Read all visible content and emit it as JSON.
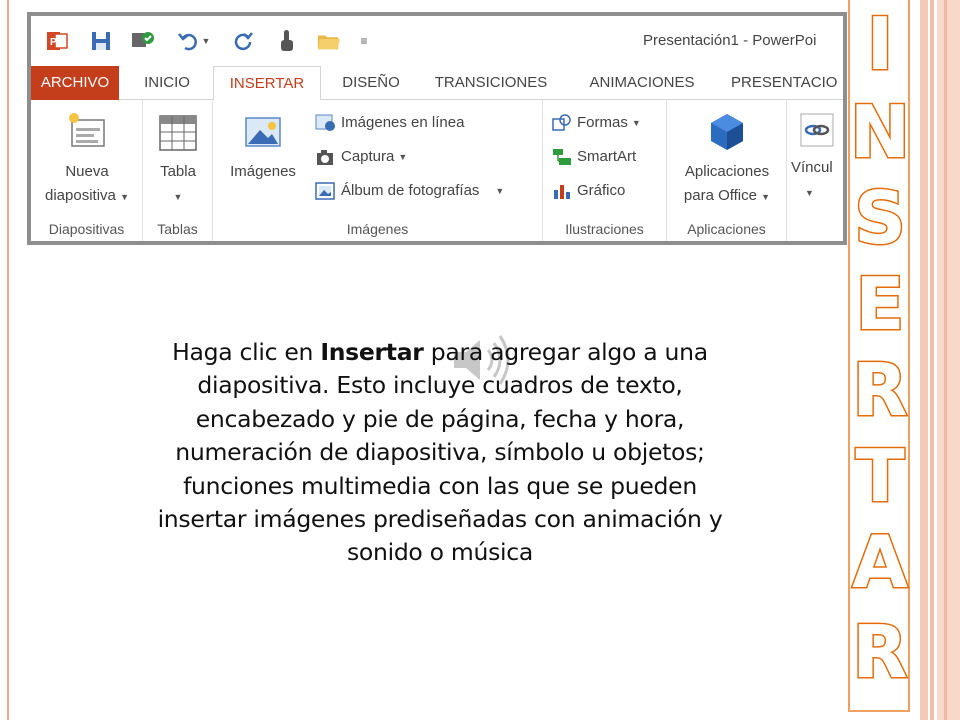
{
  "window": {
    "title": "Presentación1 - PowerPoi"
  },
  "tabs": [
    {
      "label": "ARCHIVO"
    },
    {
      "label": "INICIO"
    },
    {
      "label": "INSERTAR"
    },
    {
      "label": "DISEÑO"
    },
    {
      "label": "TRANSICIONES"
    },
    {
      "label": "ANIMACIONES"
    },
    {
      "label": "PRESENTACIO"
    }
  ],
  "groups": {
    "diapositivas": {
      "label": "Diapositivas",
      "nueva_line1": "Nueva",
      "nueva_line2": "diapositiva"
    },
    "tablas": {
      "label": "Tablas",
      "tabla": "Tabla"
    },
    "imagenes": {
      "label": "Imágenes",
      "imagenes_btn": "Imágenes",
      "en_linea": "Imágenes en línea",
      "captura": "Captura",
      "album": "Álbum de fotografías"
    },
    "ilustraciones": {
      "label": "Ilustraciones",
      "formas": "Formas",
      "smartart": "SmartArt",
      "grafico": "Gráfico"
    },
    "aplicaciones": {
      "label": "Aplicaciones",
      "line1": "Aplicaciones",
      "line2": "para Office"
    },
    "vinculos": {
      "label": "Víncul"
    }
  },
  "body": {
    "line1_pre": "Haga clic en ",
    "line1_bold": "Insertar",
    "line1_post": " para agregar algo a una",
    "line2": "diapositiva. Esto incluye cuadros de texto,",
    "line3": "encabezado y pie de página, fecha y hora,",
    "line4": "numeración de diapositiva, símbolo u objetos;",
    "line5": "funciones multimedia con las que se pueden",
    "line6": "insertar imágenes prediseñadas con animación y",
    "line7": "sonido o música"
  },
  "vertical_title": {
    "letters": [
      "I",
      "N",
      "S",
      "E",
      "R",
      "T",
      "A",
      "R"
    ]
  },
  "colors": {
    "accent_orange": "#e46c0a",
    "file_tab": "#c43e1c",
    "stripe": "#f4c9b5"
  }
}
